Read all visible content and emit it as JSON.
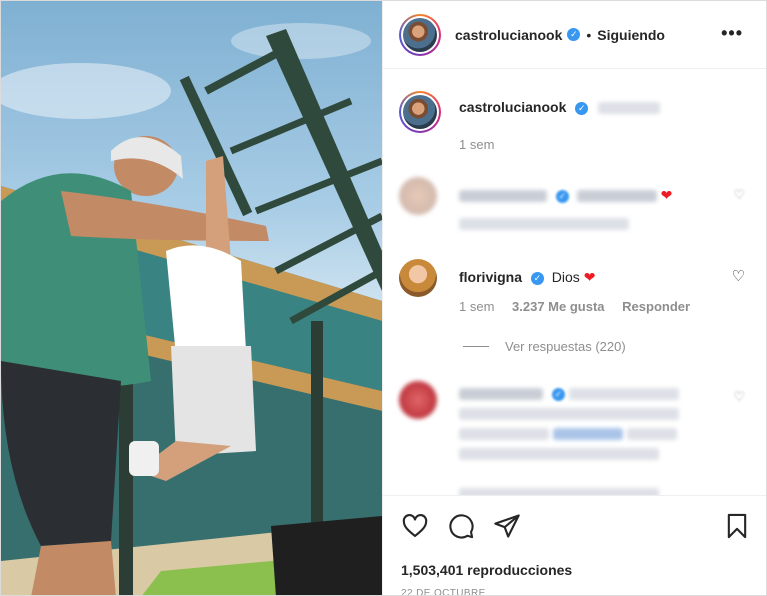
{
  "post": {
    "author": "castrolucianook",
    "follow_status": "Siguiendo",
    "more_label": "•••"
  },
  "caption": {
    "author": "castrolucianook",
    "time": "1 sem"
  },
  "comments": [
    {
      "author": "",
      "text": "",
      "blurred": true
    },
    {
      "author": "florivigna",
      "text": "Dios",
      "heart": "❤",
      "time": "1 sem",
      "likes": "3.237 Me gusta",
      "reply_label": "Responder",
      "view_replies": "Ver respuestas (220)"
    },
    {
      "author": "",
      "text": "",
      "blurred": true
    }
  ],
  "actions": {
    "like_icon": "heart-icon",
    "comment_icon": "comment-icon",
    "share_icon": "share-icon",
    "save_icon": "bookmark-icon"
  },
  "stats": {
    "views": "1,503,401 reproducciones",
    "date": "22 DE OCTUBRE"
  },
  "colors": {
    "verified": "#3897f0",
    "heart": "#ed1c24",
    "secondary_text": "#8e8e8e"
  }
}
